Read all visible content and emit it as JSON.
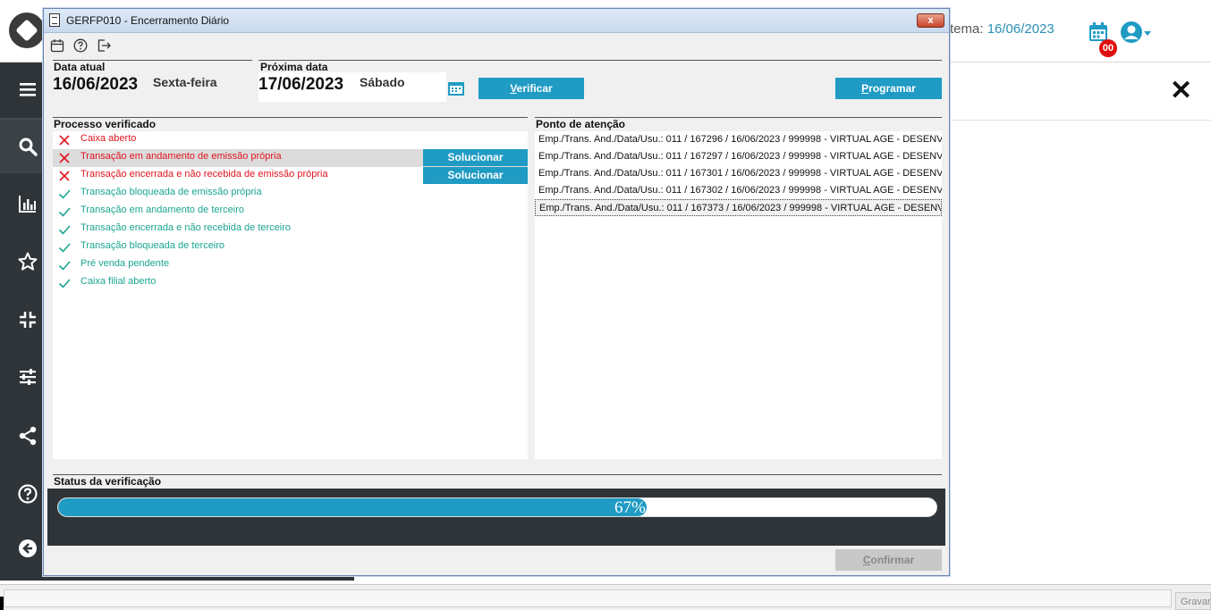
{
  "app": {
    "sys_date_prefix": "tema:",
    "sys_date_value": "16/06/2023",
    "notification_count": "00",
    "sidebar_items": [
      "menu-icon",
      "search-icon",
      "chart-icon",
      "star-icon",
      "collapse-icon",
      "sliders-icon",
      "share-icon",
      "help-icon",
      "back-icon"
    ],
    "bottom_button": "Gravar"
  },
  "dialog": {
    "title": "GERFP010 - Encerramento Diário",
    "close_label": "x",
    "toolbar": [
      "calendar-icon",
      "help-icon",
      "exit-icon"
    ],
    "current_date": {
      "label": "Data atual",
      "date": "16/06/2023",
      "weekday": "Sexta-feira"
    },
    "next_date": {
      "label": "Próxima data",
      "date": "17/06/2023",
      "weekday": "Sábado"
    },
    "verify_button": {
      "first": "V",
      "rest": "erificar"
    },
    "program_button": {
      "first": "P",
      "rest": "rogramar"
    },
    "processes": {
      "label": "Processo verificado",
      "items": [
        {
          "label": "Caixa aberto",
          "status": "fail",
          "action": ""
        },
        {
          "label": "Transação em andamento de emissão própria",
          "status": "fail",
          "action": "Solucionar"
        },
        {
          "label": "Transação encerrada e não recebida de emissão própria",
          "status": "fail",
          "action": "Solucionar"
        },
        {
          "label": "Transação bloqueada de emissão própria",
          "status": "ok",
          "action": ""
        },
        {
          "label": "Transação em andamento de terceiro",
          "status": "ok",
          "action": ""
        },
        {
          "label": "Transação encerrada e não recebida de terceiro",
          "status": "ok",
          "action": ""
        },
        {
          "label": "Transação bloqueada de terceiro",
          "status": "ok",
          "action": ""
        },
        {
          "label": "Pré venda pendente",
          "status": "ok",
          "action": ""
        },
        {
          "label": "Caixa filial aberto",
          "status": "ok",
          "action": ""
        }
      ]
    },
    "attention": {
      "label": "Ponto de atenção",
      "items": [
        "Emp./Trans. And./Data/Usu.: 011 / 167296 / 16/06/2023 / 999998 - VIRTUAL AGE - DESENVOL",
        "Emp./Trans. And./Data/Usu.: 011 / 167297 / 16/06/2023 / 999998 - VIRTUAL AGE - DESENVOL",
        "Emp./Trans. And./Data/Usu.: 011 / 167301 / 16/06/2023 / 999998 - VIRTUAL AGE - DESENVOL",
        "Emp./Trans. And./Data/Usu.: 011 / 167302 / 16/06/2023 / 999998 - VIRTUAL AGE - DESENVOL",
        "Emp./Trans. And./Data/Usu.: 011 / 167373 / 16/06/2023 / 999998 - VIRTUAL AGE - DESENVOL"
      ],
      "selected_index": 4
    },
    "status": {
      "label": "Status da verificação",
      "progress_percent": 67,
      "progress_text": "67%"
    },
    "confirm_button": {
      "first": "C",
      "rest": "onfirmar"
    }
  },
  "colors": {
    "accent": "#1f9bc4",
    "fail": "#e0141e",
    "ok": "#1aa58f",
    "sidebar": "#2f3438"
  }
}
